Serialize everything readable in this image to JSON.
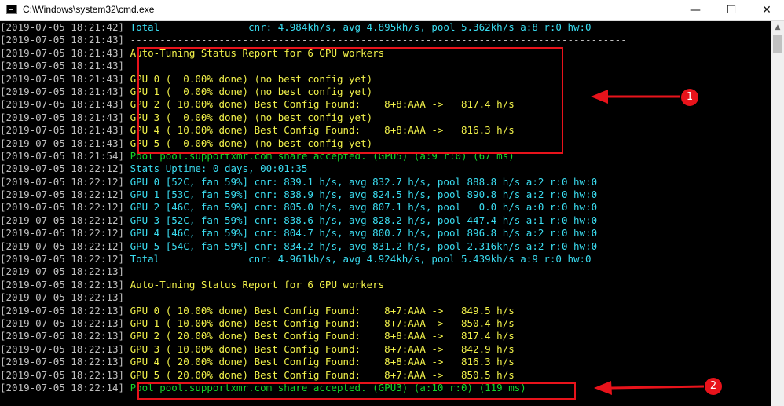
{
  "window": {
    "title": "C:\\Windows\\system32\\cmd.exe",
    "app_icon": "cmd-icon",
    "minimize": "—",
    "maximize": "☐",
    "close": "✕"
  },
  "console": {
    "lines": [
      {
        "ts": "[2019-07-05 18:21:42]",
        "text": " Total               cnr: 4.984kh/s, avg 4.895kh/s, pool 5.362kh/s a:8 r:0 hw:0",
        "color": "cyan"
      },
      {
        "ts": "[2019-07-05 18:21:43]",
        "text": " ------------------------------------------------------------------------------------",
        "color": "gray"
      },
      {
        "ts": "[2019-07-05 18:21:43]",
        "text": " Auto-Tuning Status Report for 6 GPU workers",
        "color": "yellow"
      },
      {
        "ts": "[2019-07-05 18:21:43]",
        "text": "",
        "color": "gray"
      },
      {
        "ts": "[2019-07-05 18:21:43]",
        "text": " GPU 0 (  0.00% done) (no best config yet)",
        "color": "yellow"
      },
      {
        "ts": "[2019-07-05 18:21:43]",
        "text": " GPU 1 (  0.00% done) (no best config yet)",
        "color": "yellow"
      },
      {
        "ts": "[2019-07-05 18:21:43]",
        "text": " GPU 2 ( 10.00% done) Best Config Found:    8+8:AAA ->   817.4 h/s",
        "color": "yellow"
      },
      {
        "ts": "[2019-07-05 18:21:43]",
        "text": " GPU 3 (  0.00% done) (no best config yet)",
        "color": "yellow"
      },
      {
        "ts": "[2019-07-05 18:21:43]",
        "text": " GPU 4 ( 10.00% done) Best Config Found:    8+8:AAA ->   816.3 h/s",
        "color": "yellow"
      },
      {
        "ts": "[2019-07-05 18:21:43]",
        "text": " GPU 5 (  0.00% done) (no best config yet)",
        "color": "yellow"
      },
      {
        "ts": "[2019-07-05 18:21:54]",
        "text": " Pool pool.supportxmr.com share accepted. (GPU5) (a:9 r:0) (67 ms)",
        "color": "green"
      },
      {
        "ts": "[2019-07-05 18:22:12]",
        "text": " Stats Uptime: 0 days, 00:01:35",
        "color": "cyan"
      },
      {
        "ts": "[2019-07-05 18:22:12]",
        "text": " GPU 0 [52C, fan 59%] cnr: 839.1 h/s, avg 832.7 h/s, pool 888.8 h/s a:2 r:0 hw:0",
        "color": "cyan"
      },
      {
        "ts": "[2019-07-05 18:22:12]",
        "text": " GPU 1 [53C, fan 59%] cnr: 838.9 h/s, avg 824.5 h/s, pool 890.8 h/s a:2 r:0 hw:0",
        "color": "cyan"
      },
      {
        "ts": "[2019-07-05 18:22:12]",
        "text": " GPU 2 [46C, fan 59%] cnr: 805.0 h/s, avg 807.1 h/s, pool   0.0 h/s a:0 r:0 hw:0",
        "color": "cyan"
      },
      {
        "ts": "[2019-07-05 18:22:12]",
        "text": " GPU 3 [52C, fan 59%] cnr: 838.6 h/s, avg 828.2 h/s, pool 447.4 h/s a:1 r:0 hw:0",
        "color": "cyan"
      },
      {
        "ts": "[2019-07-05 18:22:12]",
        "text": " GPU 4 [46C, fan 59%] cnr: 804.7 h/s, avg 800.7 h/s, pool 896.8 h/s a:2 r:0 hw:0",
        "color": "cyan"
      },
      {
        "ts": "[2019-07-05 18:22:12]",
        "text": " GPU 5 [54C, fan 59%] cnr: 834.2 h/s, avg 831.2 h/s, pool 2.316kh/s a:2 r:0 hw:0",
        "color": "cyan"
      },
      {
        "ts": "[2019-07-05 18:22:12]",
        "text": " Total               cnr: 4.961kh/s, avg 4.924kh/s, pool 5.439kh/s a:9 r:0 hw:0",
        "color": "cyan"
      },
      {
        "ts": "[2019-07-05 18:22:13]",
        "text": " ------------------------------------------------------------------------------------",
        "color": "gray"
      },
      {
        "ts": "[2019-07-05 18:22:13]",
        "text": " Auto-Tuning Status Report for 6 GPU workers",
        "color": "yellow"
      },
      {
        "ts": "[2019-07-05 18:22:13]",
        "text": "",
        "color": "gray"
      },
      {
        "ts": "[2019-07-05 18:22:13]",
        "text": " GPU 0 ( 10.00% done) Best Config Found:    8+7:AAA ->   849.5 h/s",
        "color": "yellow"
      },
      {
        "ts": "[2019-07-05 18:22:13]",
        "text": " GPU 1 ( 10.00% done) Best Config Found:    8+7:AAA ->   850.4 h/s",
        "color": "yellow"
      },
      {
        "ts": "[2019-07-05 18:22:13]",
        "text": " GPU 2 ( 20.00% done) Best Config Found:    8+8:AAA ->   817.4 h/s",
        "color": "yellow"
      },
      {
        "ts": "[2019-07-05 18:22:13]",
        "text": " GPU 3 ( 10.00% done) Best Config Found:    8+7:AAA ->   842.9 h/s",
        "color": "yellow"
      },
      {
        "ts": "[2019-07-05 18:22:13]",
        "text": " GPU 4 ( 20.00% done) Best Config Found:    8+8:AAA ->   816.3 h/s",
        "color": "yellow"
      },
      {
        "ts": "[2019-07-05 18:22:13]",
        "text": " GPU 5 ( 20.00% done) Best Config Found:    8+7:AAA ->   850.5 h/s",
        "color": "yellow"
      },
      {
        "ts": "[2019-07-05 18:22:14]",
        "text": " Pool pool.supportxmr.com share accepted. (GPU3) (a:10 r:0) (119 ms)",
        "color": "green"
      }
    ]
  },
  "annotations": {
    "callout_1": "1",
    "callout_2": "2",
    "highlight_color": "#e8131b"
  },
  "colors": {
    "background": "#000000",
    "timestamp": "#c0c0c0",
    "cyan": "#3adcf0",
    "yellow": "#f2f24a",
    "green": "#16d32a"
  }
}
